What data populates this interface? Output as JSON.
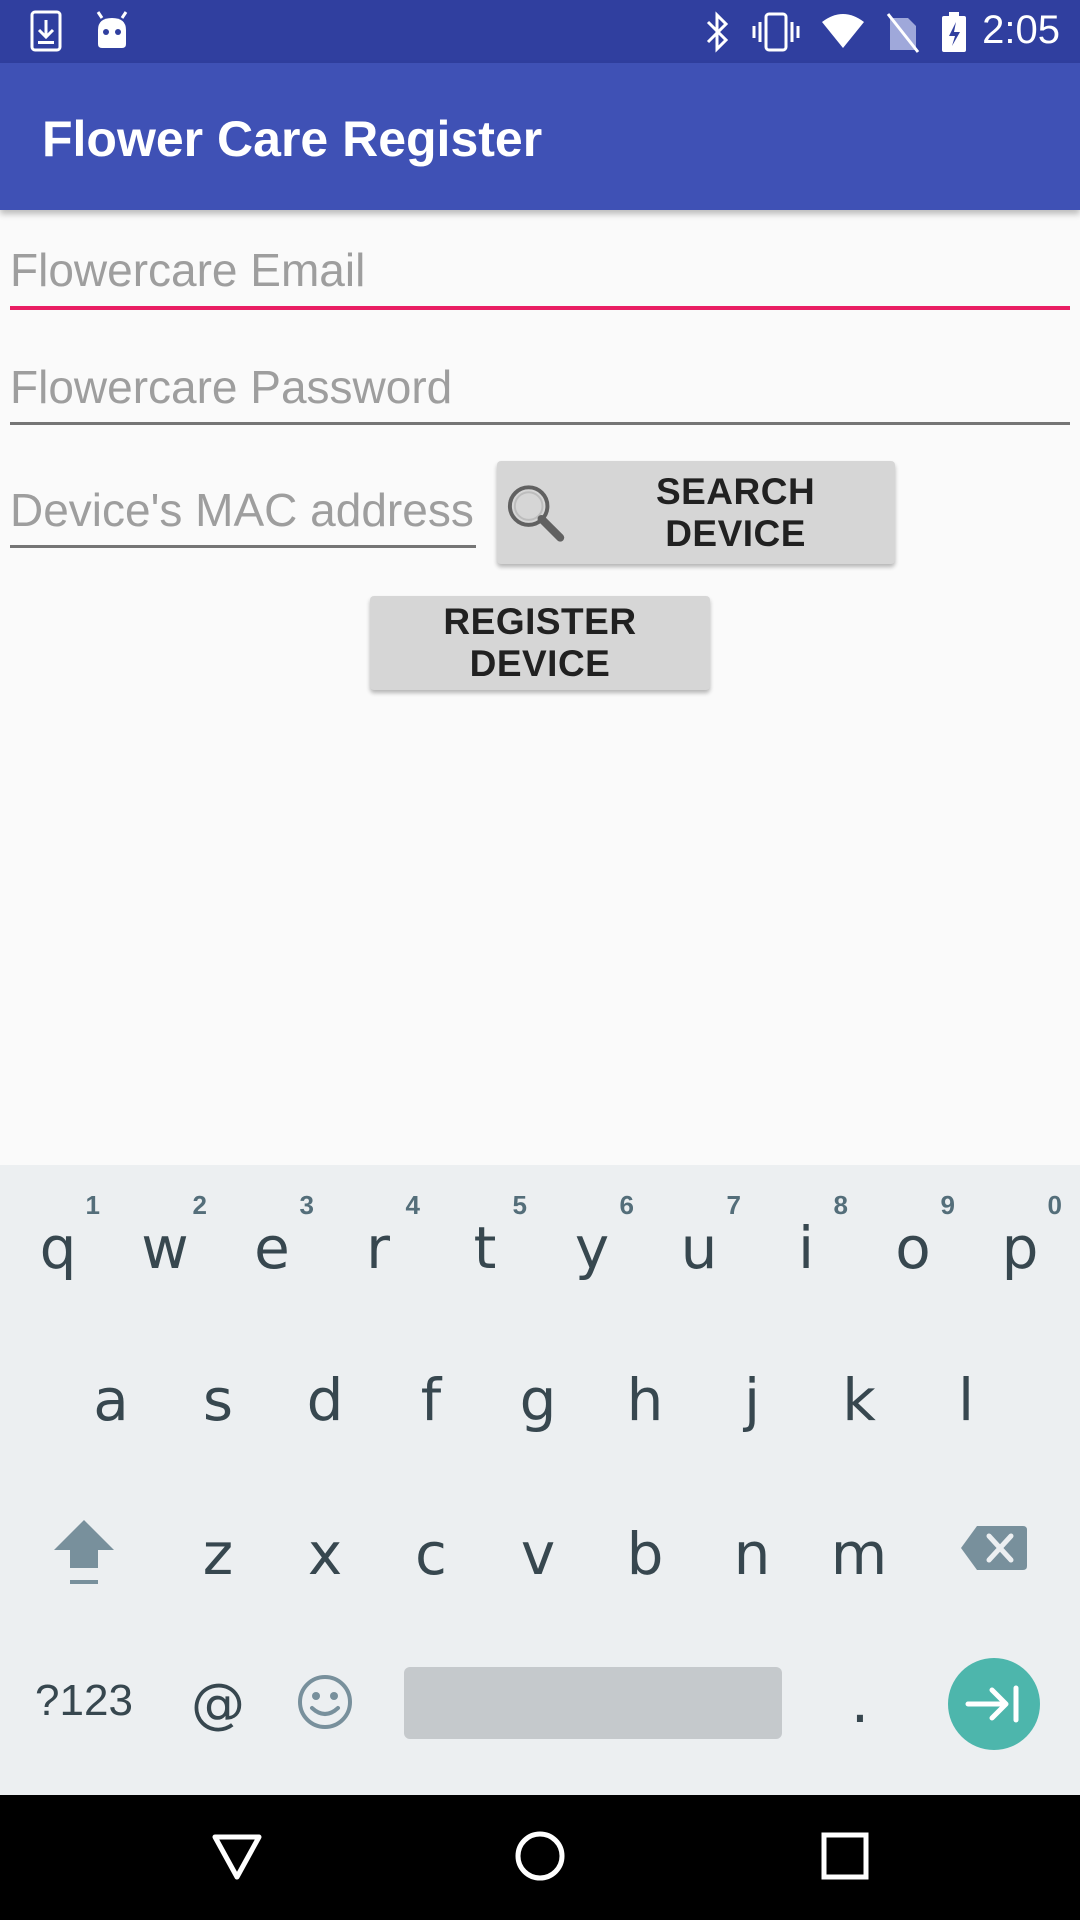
{
  "status_bar": {
    "time": "2:05",
    "left_icons": [
      "download-icon",
      "android-icon"
    ],
    "right_icons": [
      "bluetooth-icon",
      "vibrate-icon",
      "wifi-icon",
      "no-sim-icon",
      "battery-icon"
    ]
  },
  "app_bar": {
    "title": "Flower Care Register"
  },
  "form": {
    "email_placeholder": "Flowercare Email",
    "email_value": "",
    "password_placeholder": "Flowercare Password",
    "password_value": "",
    "mac_placeholder": "Device's MAC address",
    "mac_value": "",
    "search_button": "SEARCH DEVICE",
    "register_button": "REGISTER DEVICE"
  },
  "keyboard": {
    "row1": [
      {
        "key": "q",
        "hint": "1"
      },
      {
        "key": "w",
        "hint": "2"
      },
      {
        "key": "e",
        "hint": "3"
      },
      {
        "key": "r",
        "hint": "4"
      },
      {
        "key": "t",
        "hint": "5"
      },
      {
        "key": "y",
        "hint": "6"
      },
      {
        "key": "u",
        "hint": "7"
      },
      {
        "key": "i",
        "hint": "8"
      },
      {
        "key": "o",
        "hint": "9"
      },
      {
        "key": "p",
        "hint": "0"
      }
    ],
    "row2": [
      "a",
      "s",
      "d",
      "f",
      "g",
      "h",
      "j",
      "k",
      "l"
    ],
    "row3": [
      "z",
      "x",
      "c",
      "v",
      "b",
      "n",
      "m"
    ],
    "symbols_key": "?123",
    "at_key": "@",
    "period_key": "."
  },
  "colors": {
    "status_bar": "#303f9f",
    "app_bar": "#3f51b5",
    "accent": "#e91e63",
    "enter_key": "#4db6ac"
  }
}
